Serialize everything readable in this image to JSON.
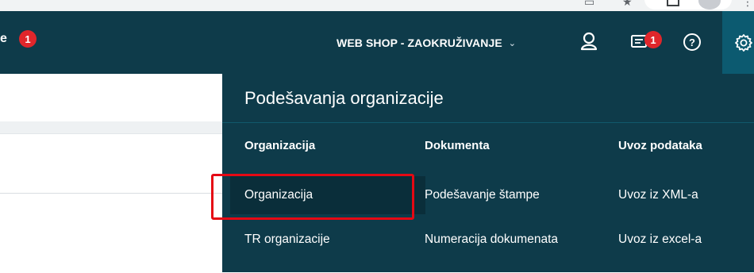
{
  "header": {
    "left_text": "e",
    "left_badge": "1",
    "organization": "WEB SHOP - ZAOKRUŽIVANJE",
    "notifications_badge": "1",
    "help_glyph": "?"
  },
  "settings_menu": {
    "title": "Podešavanja organizacije",
    "columns": [
      {
        "heading": "Organizacija",
        "items": [
          "Organizacija",
          "TR organizacije"
        ]
      },
      {
        "heading": "Dokumenta",
        "items": [
          "Podešavanje štampe",
          "Numeracija dokumenata"
        ]
      },
      {
        "heading": "Uvoz podataka",
        "items": [
          "Uvoz iz XML-a",
          "Uvoz iz excel-a"
        ]
      }
    ],
    "active_item": "Organizacija"
  },
  "icons": {
    "user": "user-icon",
    "notifications": "notifications-icon",
    "help": "help-icon",
    "settings": "gear-icon"
  },
  "colors": {
    "header_bg": "#0e3b4a",
    "settings_active_bg": "#0c5a70",
    "badge": "#e0262b",
    "active_item_bg": "#0a2e3a",
    "highlight": "#e50914"
  }
}
